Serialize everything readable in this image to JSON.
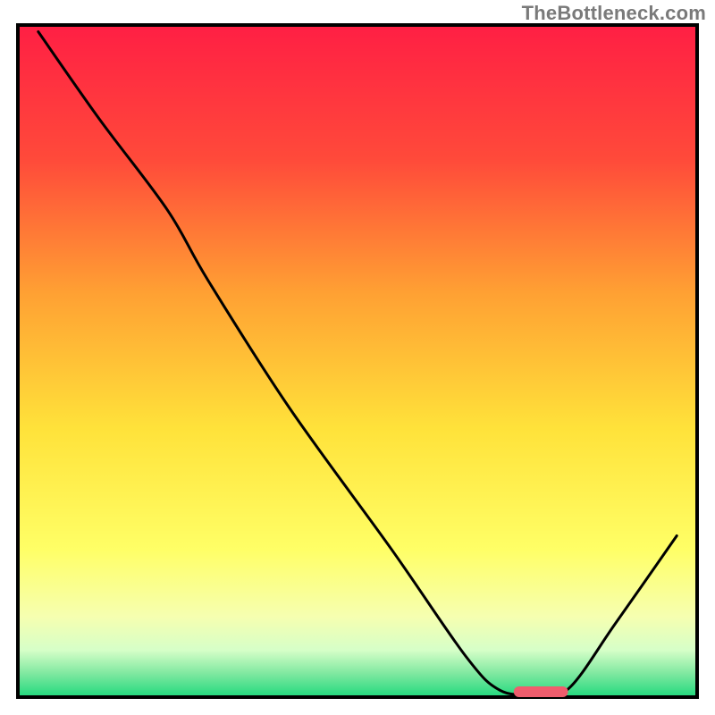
{
  "watermark": "TheBottleneck.com",
  "chart_data": {
    "type": "line",
    "title": "",
    "xlabel": "",
    "ylabel": "",
    "xlim": [
      0,
      100
    ],
    "ylim": [
      0,
      100
    ],
    "axes_visible": false,
    "grid": false,
    "background_gradient": {
      "stops": [
        {
          "offset": 0.0,
          "color": "#ff1f44"
        },
        {
          "offset": 0.2,
          "color": "#ff4a3a"
        },
        {
          "offset": 0.4,
          "color": "#ffa133"
        },
        {
          "offset": 0.6,
          "color": "#ffe23a"
        },
        {
          "offset": 0.78,
          "color": "#ffff66"
        },
        {
          "offset": 0.88,
          "color": "#f6ffb0"
        },
        {
          "offset": 0.93,
          "color": "#d6ffc8"
        },
        {
          "offset": 0.965,
          "color": "#7fe8a0"
        },
        {
          "offset": 1.0,
          "color": "#20d97d"
        }
      ]
    },
    "series": [
      {
        "name": "bottleneck-curve",
        "color": "#000000",
        "points": [
          {
            "x": 3.0,
            "y": 99.0
          },
          {
            "x": 12.0,
            "y": 86.0
          },
          {
            "x": 22.0,
            "y": 72.5
          },
          {
            "x": 28.0,
            "y": 62.0
          },
          {
            "x": 40.0,
            "y": 43.0
          },
          {
            "x": 55.0,
            "y": 22.0
          },
          {
            "x": 66.0,
            "y": 6.0
          },
          {
            "x": 71.0,
            "y": 1.0
          },
          {
            "x": 76.0,
            "y": 0.5
          },
          {
            "x": 81.0,
            "y": 1.2
          },
          {
            "x": 88.0,
            "y": 11.0
          },
          {
            "x": 97.0,
            "y": 24.0
          }
        ]
      }
    ],
    "marker": {
      "name": "optimal-marker",
      "color": "#ef5d6d",
      "x_start": 73.0,
      "x_end": 81.0,
      "y": 0.8
    },
    "frame_color": "#000000"
  }
}
